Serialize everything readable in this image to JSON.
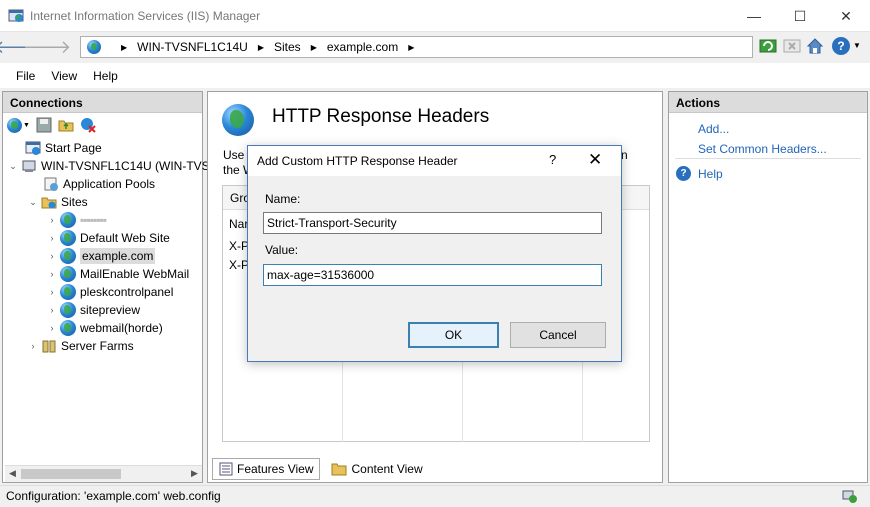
{
  "window": {
    "title": "Internet Information Services (IIS) Manager",
    "minimize": "—",
    "maximize": "☐",
    "close": "✕"
  },
  "address": {
    "crumbs": [
      "WIN-TVSNFL1C14U",
      "Sites",
      "example.com"
    ]
  },
  "menu": [
    "File",
    "View",
    "Help"
  ],
  "connections": {
    "header": "Connections",
    "tree": [
      {
        "label": "Start Page"
      },
      {
        "label": "WIN-TVSNFL1C14U (WIN-TVS"
      },
      {
        "label": "Application Pools"
      },
      {
        "label": "Sites"
      },
      {
        "label": "▪▪▪▪▪▪▪▪"
      },
      {
        "label": "Default Web Site"
      },
      {
        "label": "example.com"
      },
      {
        "label": "MailEnable WebMail"
      },
      {
        "label": "pleskcontrolpanel"
      },
      {
        "label": "sitepreview"
      },
      {
        "label": "webmail(horde)"
      },
      {
        "label": "Server Farms"
      }
    ]
  },
  "center": {
    "title": "HTTP Response Headers",
    "desc_line1": "Use",
    "desc_line2": "the W",
    "desc_right": "n",
    "grid_header": "Gro",
    "grid_rows": [
      "Nar",
      "X-P",
      "X-P"
    ],
    "tabs": {
      "features": "Features View",
      "content": "Content View"
    }
  },
  "actions": {
    "header": "Actions",
    "add": "Add...",
    "set_common": "Set Common Headers...",
    "help": "Help"
  },
  "status": {
    "text": "Configuration: 'example.com' web.config"
  },
  "dialog": {
    "title": "Add Custom HTTP Response Header",
    "help": "?",
    "close": "✕",
    "name_label": "Name:",
    "name_value": "Strict-Transport-Security",
    "value_label": "Value:",
    "value_value": "max-age=31536000",
    "ok": "OK",
    "cancel": "Cancel"
  }
}
